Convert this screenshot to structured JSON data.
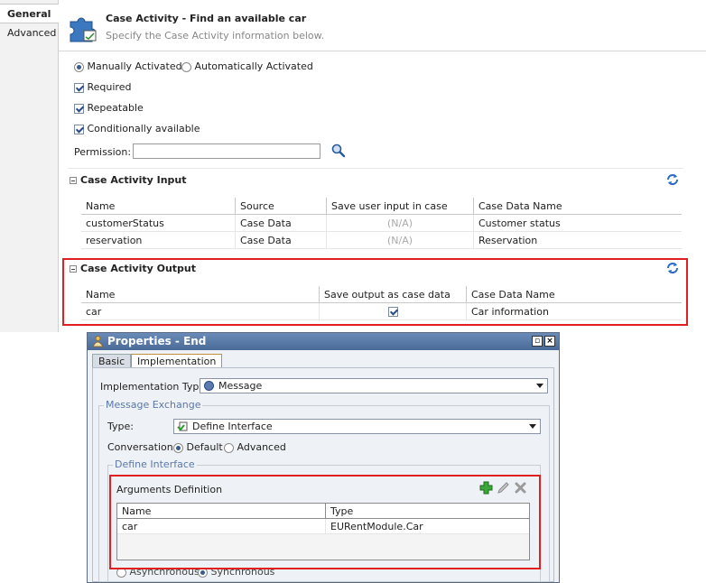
{
  "top": {
    "nav": {
      "general": "General",
      "advanced": "Advanced"
    },
    "header": {
      "title": "Case Activity - Find an available car",
      "subtitle": "Specify the Case Activity information below."
    },
    "activation": {
      "manual": "Manually Activated",
      "automatic": "Automatically Activated"
    },
    "checks": {
      "required": "Required",
      "repeatable": "Repeatable",
      "conditional": "Conditionally available"
    },
    "permission": {
      "label": "Permission:",
      "value": ""
    },
    "input_section": {
      "title": "Case Activity Input",
      "columns": [
        "Name",
        "Source",
        "Save user input in case",
        "Case Data Name"
      ],
      "rows": [
        [
          "customerStatus",
          "Case Data",
          "(N/A)",
          "Customer status"
        ],
        [
          "reservation",
          "Case Data",
          "(N/A)",
          "Reservation"
        ]
      ]
    },
    "output_section": {
      "title": "Case Activity Output",
      "columns": [
        "Name",
        "Save output as case data",
        "Case Data Name"
      ],
      "rows": [
        {
          "name": "car",
          "save": true,
          "data_name": "Car information"
        }
      ]
    },
    "colors": {
      "highlight": "#e02020"
    }
  },
  "dialog": {
    "title": "Properties - End",
    "tabs": {
      "basic": "Basic",
      "implementation": "Implementation"
    },
    "impl_type": {
      "label": "Implementation Type:",
      "value": "Message"
    },
    "message_exchange": {
      "legend": "Message Exchange",
      "type_label": "Type:",
      "type_value": "Define Interface",
      "conversation_label": "Conversation:",
      "conv_default": "Default",
      "conv_advanced": "Advanced"
    },
    "define_interface": {
      "legend": "Define Interface",
      "args_title": "Arguments Definition",
      "columns": [
        "Name",
        "Type"
      ],
      "rows": [
        [
          "car",
          "EURentModule.Car"
        ]
      ]
    },
    "mode": {
      "asynchronous": "Asynchronous",
      "synchronous": "Synchronous"
    }
  }
}
